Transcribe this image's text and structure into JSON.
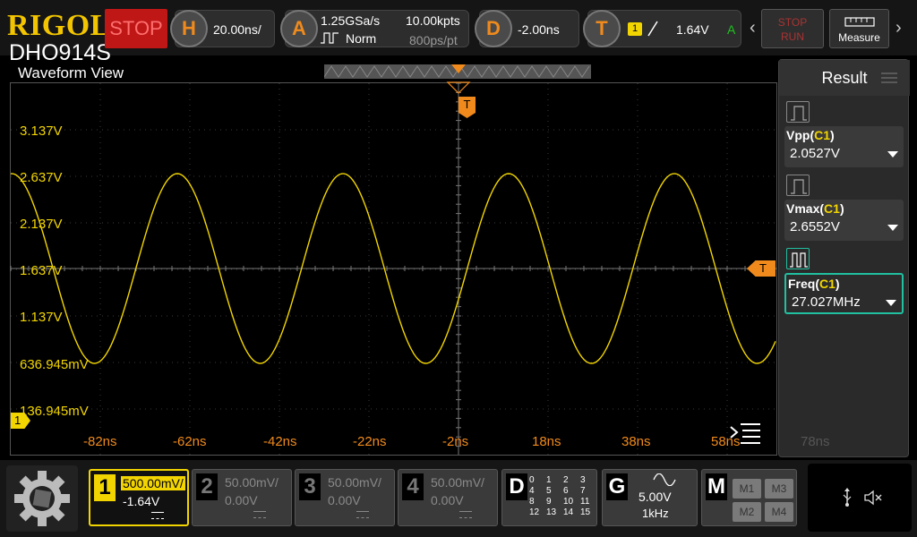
{
  "header": {
    "logo": "RIGOL",
    "model": "DHO914S",
    "run_state": "STOP",
    "horizontal": {
      "key": "H",
      "timebase": "20.00ns/"
    },
    "acquire": {
      "key": "A",
      "sample_rate": "1.25GSa/s",
      "mode": "Norm",
      "memory_depth": "10.00kpts",
      "sample_interval": "800ps/pt"
    },
    "delay": {
      "key": "D",
      "value": "-2.00ns"
    },
    "trigger": {
      "key": "T",
      "source": "1",
      "level": "1.64V",
      "mode": "A"
    },
    "stop_run_label_top": "STOP",
    "stop_run_label_bottom": "RUN",
    "measure_label": "Measure"
  },
  "waveform": {
    "title": "Waveform View",
    "volt_labels": [
      "3.137V",
      "2.637V",
      "2.137V",
      "1.637V",
      "1.137V",
      "636.945mV",
      "136.945mV"
    ],
    "time_labels": [
      "-82ns",
      "-62ns",
      "-42ns",
      "-22ns",
      "-2ns",
      "18ns",
      "38ns",
      "58ns",
      "78ns"
    ],
    "channel_marker": "1",
    "trigger_marker": "T",
    "trace_color": "#f2d500"
  },
  "result": {
    "title": "Result",
    "items": [
      {
        "name": "Vpp",
        "source": "C1",
        "value": "2.0527V"
      },
      {
        "name": "Vmax",
        "source": "C1",
        "value": "2.6552V"
      },
      {
        "name": "Freq",
        "source": "C1",
        "value": "27.027MHz"
      }
    ]
  },
  "channels": [
    {
      "num": "1",
      "scale": "500.00mV/",
      "offset": "-1.64V",
      "active": true,
      "color": "#f2d500"
    },
    {
      "num": "2",
      "scale": "50.00mV/",
      "offset": "0.00V",
      "active": false
    },
    {
      "num": "3",
      "scale": "50.00mV/",
      "offset": "0.00V",
      "active": false
    },
    {
      "num": "4",
      "scale": "50.00mV/",
      "offset": "0.00V",
      "active": false
    }
  ],
  "digital": {
    "label": "D",
    "bits": [
      "0",
      "1",
      "2",
      "3",
      "4",
      "5",
      "6",
      "7",
      "8",
      "9",
      "10",
      "11",
      "12",
      "13",
      "14",
      "15"
    ]
  },
  "generator": {
    "label": "G",
    "amplitude": "5.00V",
    "frequency": "1kHz"
  },
  "math": {
    "label": "M",
    "buttons": [
      "M1",
      "M3",
      "M2",
      "M4"
    ]
  },
  "colors": {
    "accent_orange": "#f08a1c",
    "channel1_yellow": "#f2d500",
    "result_highlight": "#20c0a0",
    "stop_red": "#bf1616"
  }
}
